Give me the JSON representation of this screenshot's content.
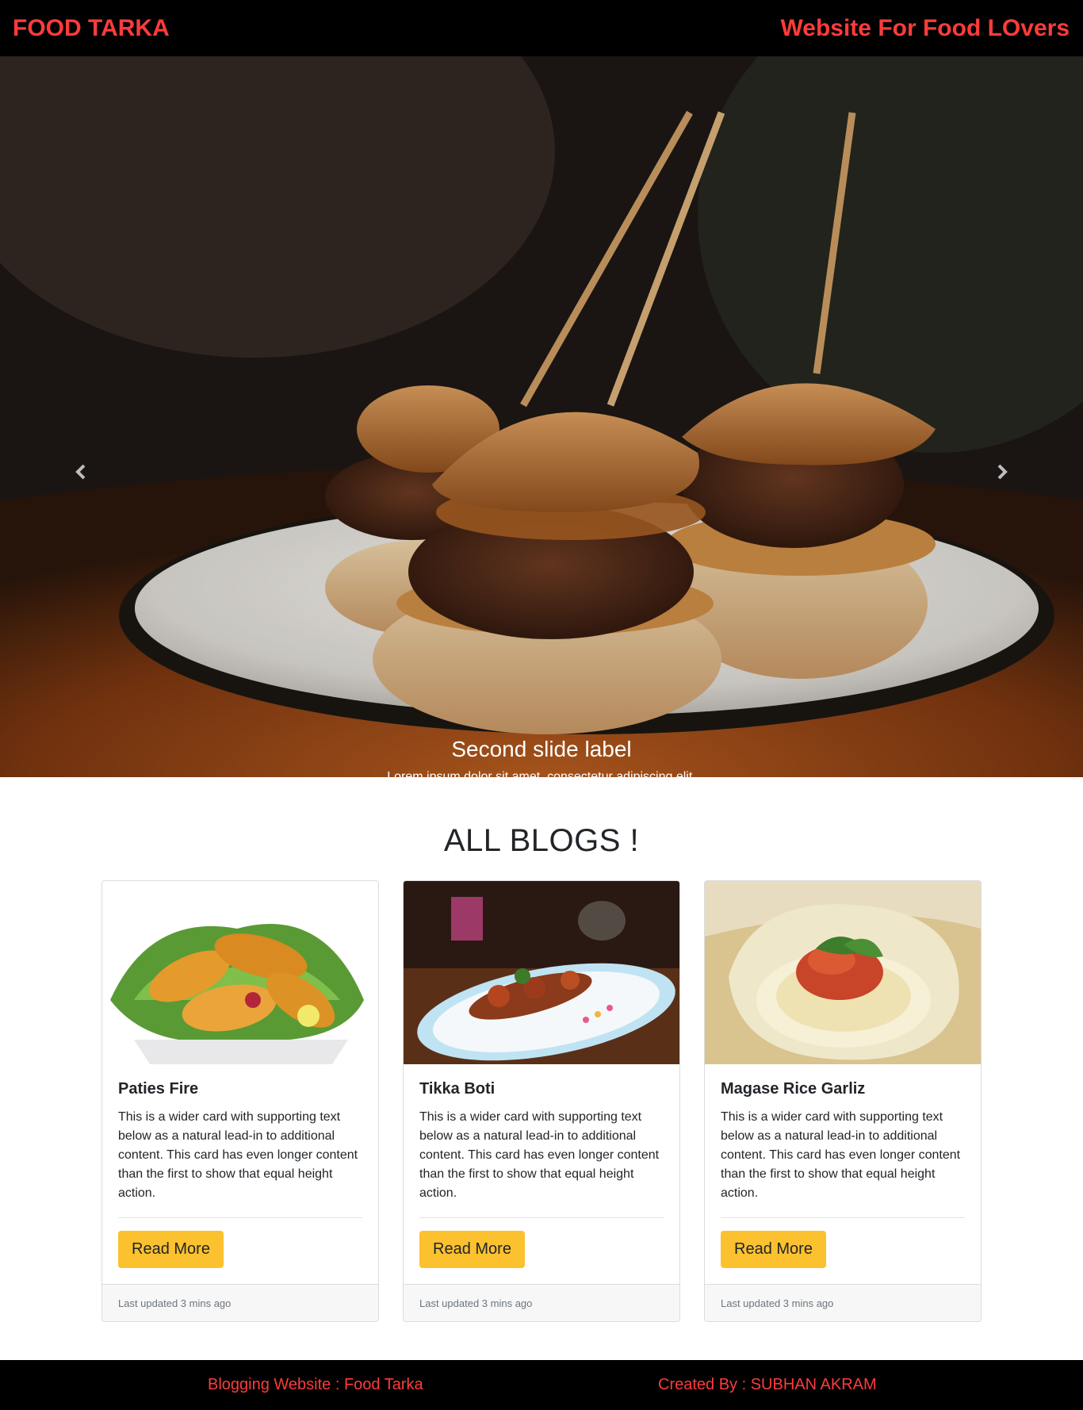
{
  "header": {
    "brand": "FOOD TARKA",
    "tagline": "Website For Food LOvers"
  },
  "carousel": {
    "caption_label": "Second slide label",
    "caption_text": "Lorem ipsum dolor sit amet, consectetur adipiscing elit.",
    "slide_count": 3,
    "active_slide": 2,
    "prev_icon": "chevron-left-icon",
    "next_icon": "chevron-right-icon"
  },
  "blogs": {
    "heading": "ALL BLOGS !",
    "cards": [
      {
        "title": "Paties Fire",
        "text": "This is a wider card with supporting text below as a natural lead-in to additional content. This card has even longer content than the first to show that equal height action.",
        "button": "Read More",
        "footer": "Last updated 3 mins ago"
      },
      {
        "title": "Tikka Boti",
        "text": "This is a wider card with supporting text below as a natural lead-in to additional content. This card has even longer content than the first to show that equal height action.",
        "button": "Read More",
        "footer": "Last updated 3 mins ago"
      },
      {
        "title": "Magase Rice Garliz",
        "text": "This is a wider card with supporting text below as a natural lead-in to additional content. This card has even longer content than the first to show that equal height action.",
        "button": "Read More",
        "footer": "Last updated 3 mins ago"
      }
    ]
  },
  "footer": {
    "left": "Blogging Website : Food Tarka",
    "right": "Created By : SUBHAN AKRAM"
  },
  "colors": {
    "brand_red": "#ff3b3b",
    "button_yellow": "#fcc12e",
    "bar_black": "#000000"
  }
}
